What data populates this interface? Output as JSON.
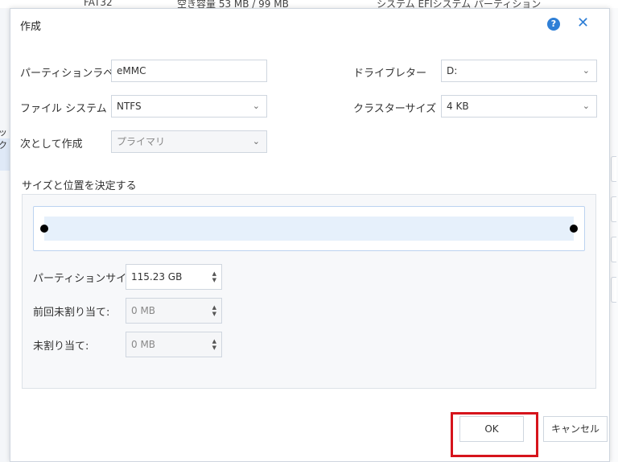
{
  "background": {
    "fs": "FAT32",
    "free": "空き容量 53 MB / 99 MB",
    "type": "システム  EFIシステム パーティション",
    "left_text": "ック"
  },
  "dialog": {
    "title": "作成",
    "help_glyph": "?",
    "close_glyph": "✕"
  },
  "form": {
    "partition_label": {
      "label": "パーティションラベル",
      "value": "eMMC"
    },
    "drive_letter": {
      "label": "ドライブレター",
      "value": "D:"
    },
    "file_system": {
      "label": "ファイル システム",
      "value": "NTFS"
    },
    "cluster_size": {
      "label": "クラスターサイズ",
      "value": "4 KB"
    },
    "create_as": {
      "label": "次として作成",
      "value": "プライマリ"
    }
  },
  "size_group": {
    "label": "サイズと位置を決定する",
    "partition_size": {
      "label": "パーティションサイズ:",
      "value": "115.23 GB"
    },
    "unallocated_before": {
      "label": "前回未割り当て:",
      "value": "0 MB"
    },
    "unallocated_after": {
      "label": "未割り当て:",
      "value": "0 MB"
    }
  },
  "buttons": {
    "ok": "OK",
    "cancel": "キャンセル"
  },
  "colors": {
    "accent": "#2f7fd6",
    "highlight": "#d6141c",
    "slider_fill": "#e6f0fb"
  }
}
